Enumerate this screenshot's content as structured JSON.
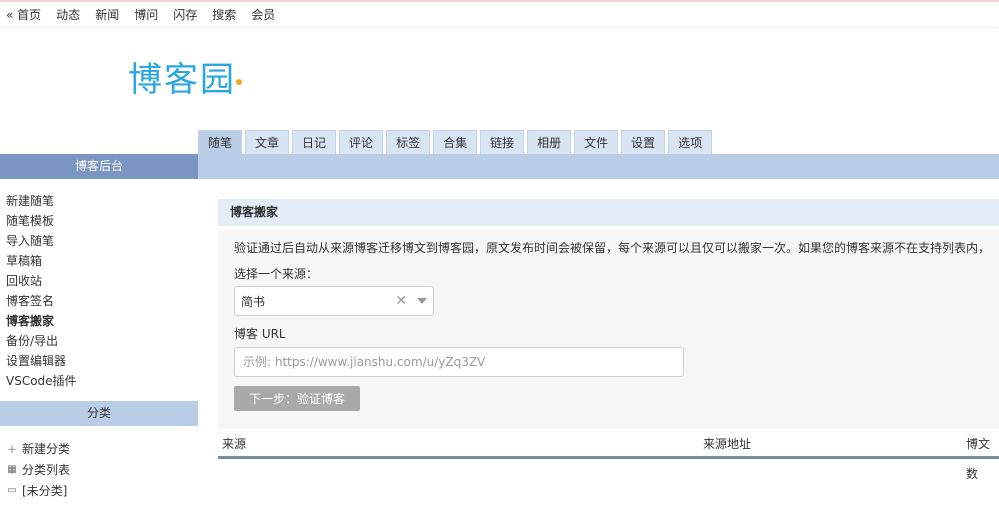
{
  "topnav": {
    "items": [
      "« 首页",
      "动态",
      "新闻",
      "博问",
      "闪存",
      "搜索",
      "会员"
    ]
  },
  "logo": {
    "text": "博客园",
    "color": "#2aa7e0",
    "accent": "#f5a623"
  },
  "tabs": [
    "随笔",
    "文章",
    "日记",
    "评论",
    "标签",
    "合集",
    "链接",
    "相册",
    "文件",
    "设置",
    "选项"
  ],
  "sidebar": {
    "title": "博客后台",
    "items": [
      "新建随笔",
      "随笔模板",
      "导入随笔",
      "草稿箱",
      "回收站",
      "博客签名",
      "博客搬家",
      "备份/导出",
      "设置编辑器",
      "VSCode插件"
    ],
    "current": "博客搬家",
    "category_title": "分类",
    "categories": [
      {
        "icon": "plus-icon",
        "label": "新建分类"
      },
      {
        "icon": "grid-icon",
        "label": "分类列表"
      },
      {
        "icon": "folder-icon",
        "label": "[未分类]"
      }
    ]
  },
  "main": {
    "title": "博客搬家",
    "description": "验证通过后自动从来源博客迁移博文到博客园，原文发布时间会被保留，每个来源可以且仅可以搬家一次。如果您的博客来源不在支持列表内，请",
    "source_label": "选择一个来源：",
    "source_value": "简书",
    "url_label": "博客 URL",
    "url_placeholder": "示例: https://www.jianshu.com/u/yZq3ZV",
    "url_value": "",
    "next_button": "下一步：验证博客",
    "table_headers": [
      "来源",
      "来源地址",
      "博文数"
    ]
  }
}
